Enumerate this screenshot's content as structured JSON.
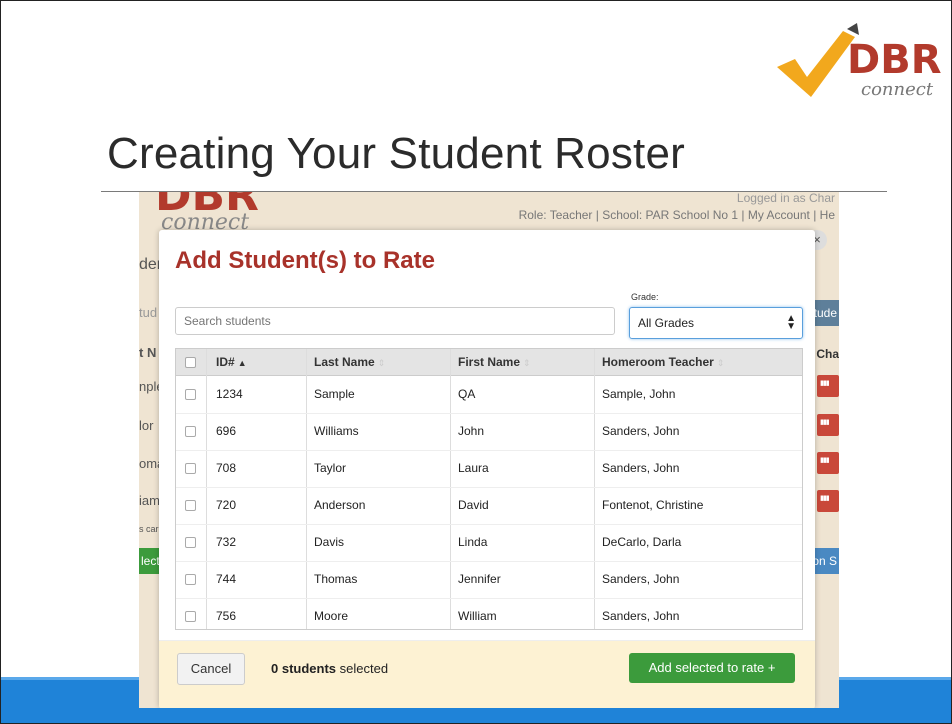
{
  "slide": {
    "title": "Creating Your Student Roster",
    "logo": {
      "brand": "DBR",
      "tagline": "connect",
      "accent": "#f2a81d",
      "brand_color": "#b23a2c"
    }
  },
  "app": {
    "logo_brand": "DBR",
    "logo_tagline": "connect",
    "logged_in": "Logged in as Char",
    "role_line": "Role: Teacher | School: PAR School No 1 | My Account | He",
    "background_fragments": {
      "tab_label": "den",
      "search_fragment": "tud",
      "col_fragment": "t N",
      "right_button": "tude",
      "right_col": "Cha",
      "rows": [
        "nple",
        "lor",
        "oma",
        "iam"
      ],
      "note": "s car",
      "left_button": "lect",
      "right_footer_button": "on S"
    }
  },
  "modal": {
    "title": "Add Student(s) to Rate",
    "close_glyph": "×",
    "search_placeholder": "Search students",
    "grade_label": "Grade:",
    "grade_value": "All Grades",
    "columns": {
      "id": "ID#",
      "last": "Last Name",
      "first": "First Name",
      "teacher": "Homeroom Teacher"
    },
    "rows": [
      {
        "id": "1234",
        "last": "Sample",
        "first": "QA",
        "teacher": "Sample, John"
      },
      {
        "id": "696",
        "last": "Williams",
        "first": "John",
        "teacher": "Sanders, John"
      },
      {
        "id": "708",
        "last": "Taylor",
        "first": "Laura",
        "teacher": "Sanders, John"
      },
      {
        "id": "720",
        "last": "Anderson",
        "first": "David",
        "teacher": "Fontenot, Christine"
      },
      {
        "id": "732",
        "last": "Davis",
        "first": "Linda",
        "teacher": "DeCarlo, Darla"
      },
      {
        "id": "744",
        "last": "Thomas",
        "first": "Jennifer",
        "teacher": "Sanders, John"
      },
      {
        "id": "756",
        "last": "Moore",
        "first": "William",
        "teacher": "Sanders, John"
      }
    ],
    "footer": {
      "cancel": "Cancel",
      "count_bold": "0 students",
      "count_rest": " selected",
      "add": "Add selected to rate +"
    }
  },
  "colors": {
    "band": "#1f83d8",
    "modal_title": "#a8322a",
    "add_button": "#3c9b3c",
    "footer_bg": "#fdf2d3"
  }
}
